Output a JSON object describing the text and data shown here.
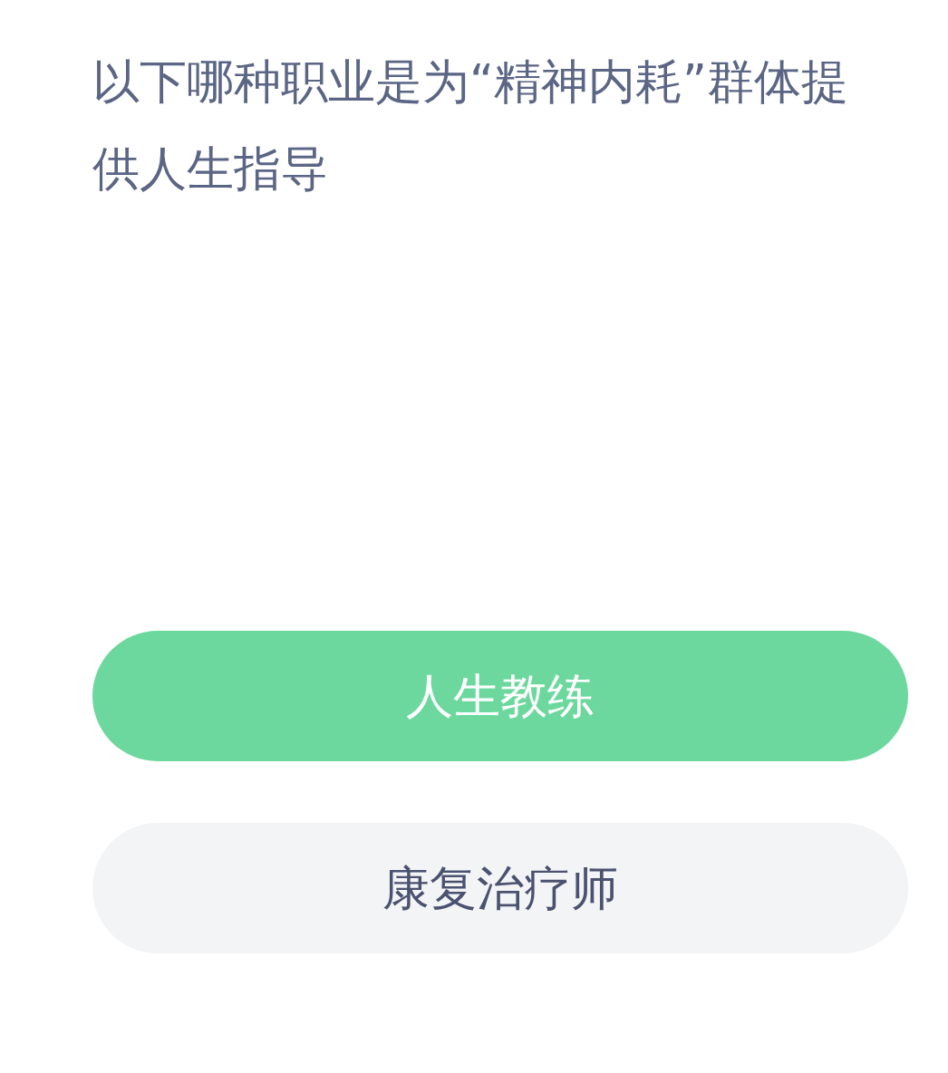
{
  "question": "以下哪种职业是为“精神内耗”群体提供人生指导",
  "options": [
    {
      "label": "人生教练",
      "selected": true
    },
    {
      "label": "康复治疗师",
      "selected": false
    }
  ]
}
